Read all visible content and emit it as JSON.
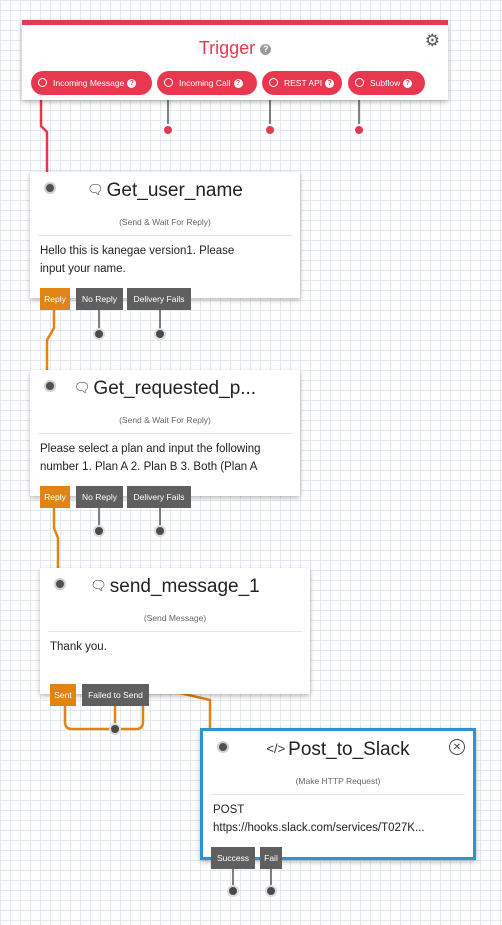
{
  "trigger": {
    "title": "Trigger",
    "help": "?",
    "settings_icon": "gear-icon",
    "pills": [
      {
        "label": "Incoming Message"
      },
      {
        "label": "Incoming Call"
      },
      {
        "label": "REST API"
      },
      {
        "label": "Subflow"
      }
    ]
  },
  "nodes": {
    "get_user_name": {
      "icon": "chat-bubble-icon",
      "title": "Get_user_name",
      "subtitle": "(Send & Wait For Reply)",
      "body": [
        "Hello this is kanegae version1. Please",
        "input your name."
      ],
      "buttons": [
        "Reply",
        "No Reply",
        "Delivery Fails"
      ]
    },
    "get_requested_plan": {
      "icon": "chat-bubble-icon",
      "title": "Get_requested_p...",
      "subtitle": "(Send & Wait For Reply)",
      "body": [
        "Please select a plan and input the following",
        "number 1. Plan A 2. Plan B 3. Both (Plan A"
      ],
      "buttons": [
        "Reply",
        "No Reply",
        "Delivery Fails"
      ]
    },
    "send_message_1": {
      "icon": "chat-bubble-icon",
      "title": "send_message_1",
      "subtitle": "(Send Message)",
      "body": [
        "Thank you."
      ],
      "buttons": [
        "Sent",
        "Failed to Send"
      ]
    },
    "post_to_slack": {
      "icon": "code-icon",
      "title": "Post_to_Slack",
      "subtitle": "(Make HTTP Request)",
      "body": [
        "POST",
        "https://hooks.slack.com/services/T027K..."
      ],
      "buttons": [
        "Success",
        "Fail"
      ]
    }
  },
  "colors": {
    "trigger": "#e8384f",
    "reply_active": "#e28413",
    "button_gray": "#5f5f5f",
    "http_border": "#2f93cf"
  }
}
